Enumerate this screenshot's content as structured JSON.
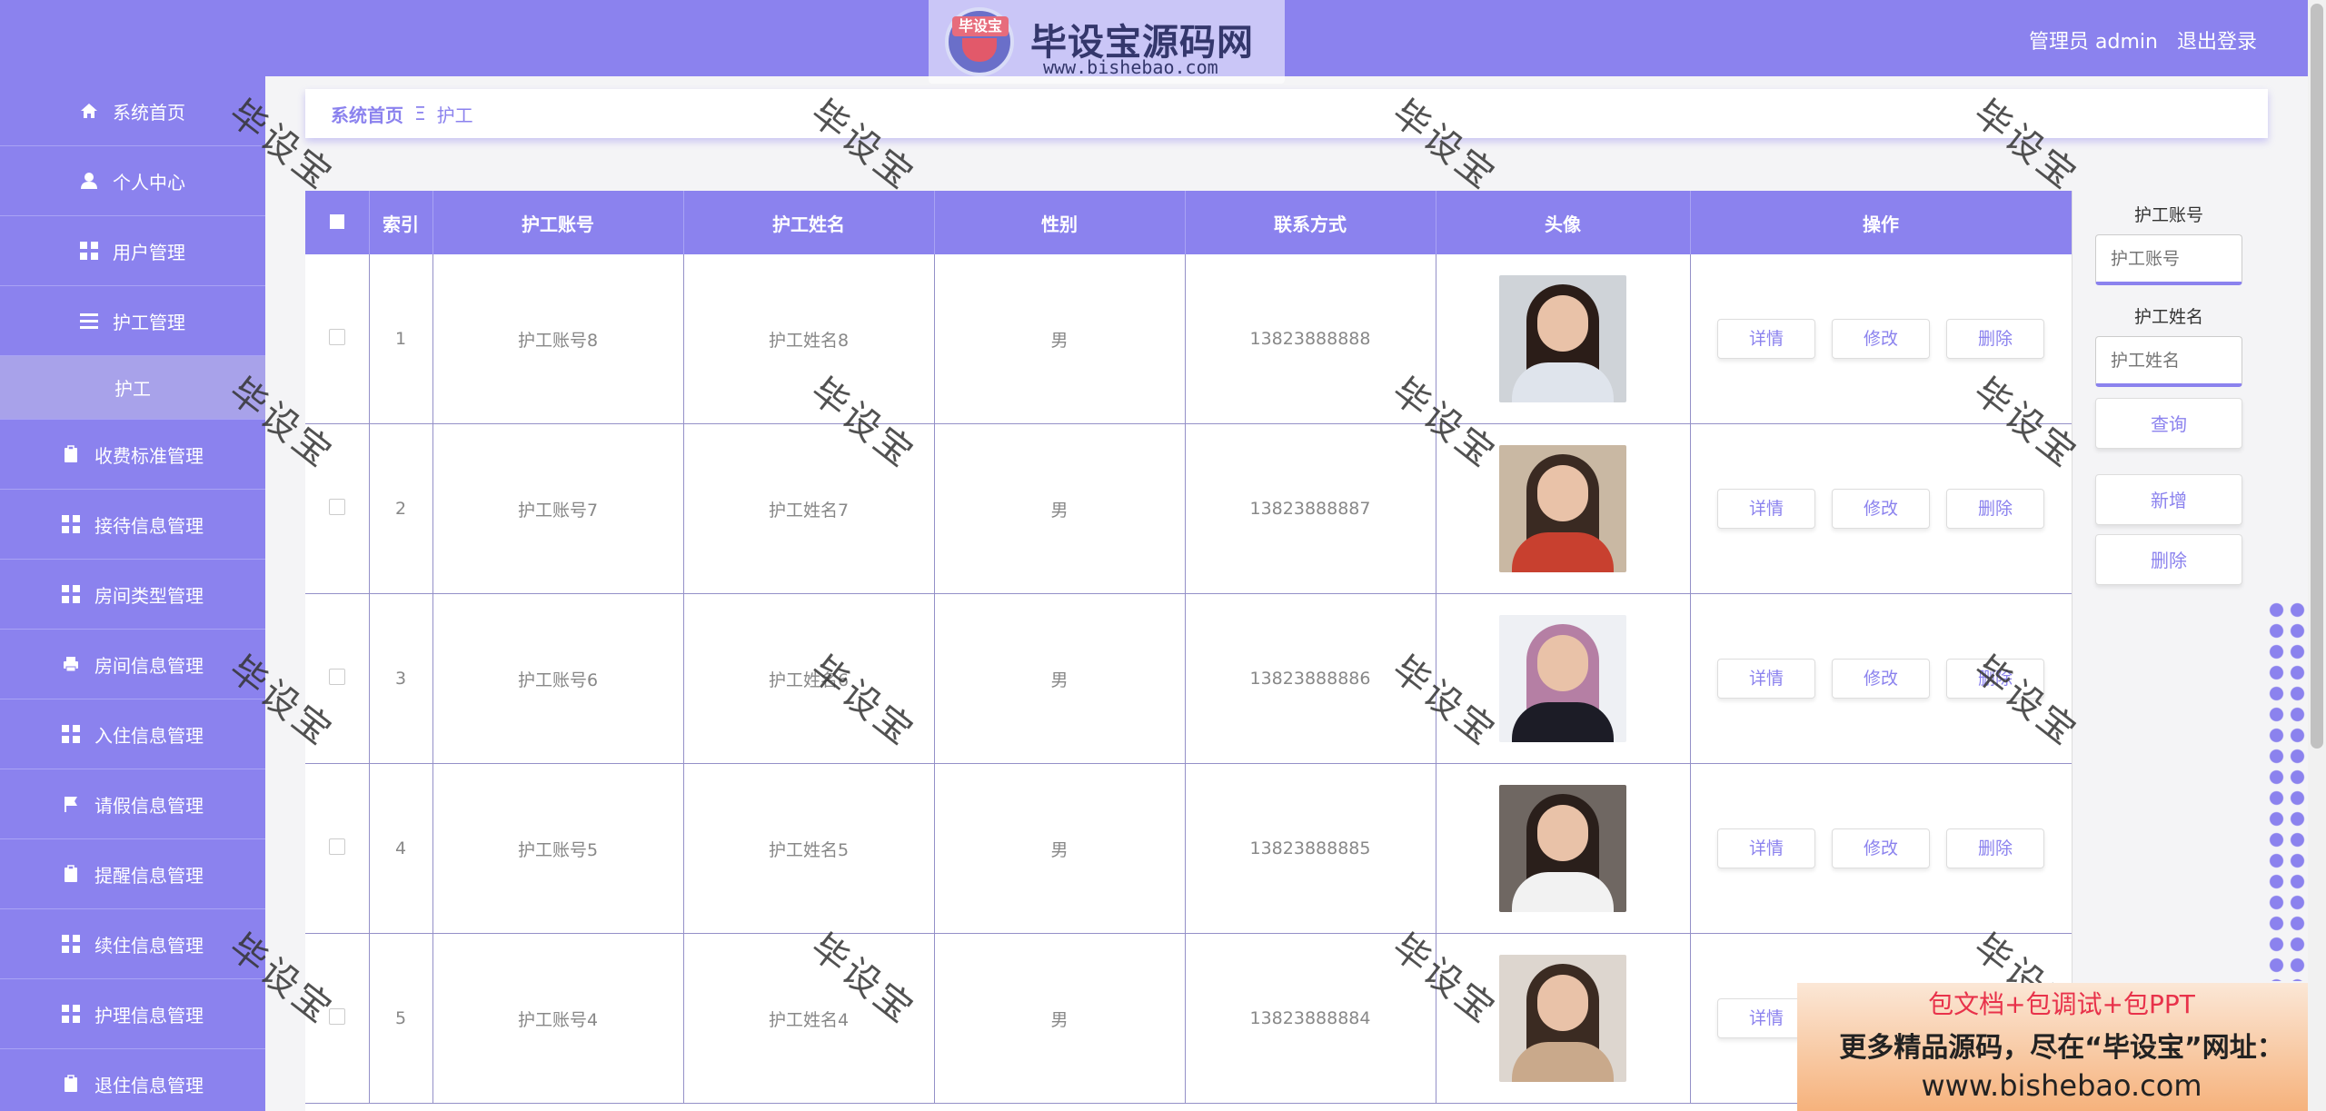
{
  "header": {
    "logo_badge": "毕设宝",
    "logo_title": "毕设宝源码网",
    "logo_url": "www.bishebao.com",
    "user_label": "管理员 admin",
    "logout_label": "退出登录"
  },
  "sidebar": {
    "items": [
      {
        "label": "系统首页",
        "icon": "home-icon"
      },
      {
        "label": "个人中心",
        "icon": "user-icon"
      },
      {
        "label": "用户管理",
        "icon": "grid-icon"
      },
      {
        "label": "护工管理",
        "icon": "list-icon"
      },
      {
        "label": "护工",
        "icon": ""
      },
      {
        "label": "收费标准管理",
        "icon": "clipboard-icon"
      },
      {
        "label": "接待信息管理",
        "icon": "grid-icon"
      },
      {
        "label": "房间类型管理",
        "icon": "grid-icon"
      },
      {
        "label": "房间信息管理",
        "icon": "printer-icon"
      },
      {
        "label": "入住信息管理",
        "icon": "grid-icon"
      },
      {
        "label": "请假信息管理",
        "icon": "flag-icon"
      },
      {
        "label": "提醒信息管理",
        "icon": "clipboard-icon"
      },
      {
        "label": "续住信息管理",
        "icon": "grid-icon"
      },
      {
        "label": "护理信息管理",
        "icon": "grid-icon"
      },
      {
        "label": "退住信息管理",
        "icon": "clipboard-icon"
      }
    ]
  },
  "breadcrumb": {
    "home": "系统首页",
    "separator": "Ξ",
    "current": "护工"
  },
  "table": {
    "headers": [
      "",
      "索引",
      "护工账号",
      "护工姓名",
      "性别",
      "联系方式",
      "头像",
      "操作"
    ],
    "rows": [
      {
        "index": "1",
        "account": "护工账号8",
        "name": "护工姓名8",
        "gender": "男",
        "phone": "13823888888"
      },
      {
        "index": "2",
        "account": "护工账号7",
        "name": "护工姓名7",
        "gender": "男",
        "phone": "13823888887"
      },
      {
        "index": "3",
        "account": "护工账号6",
        "name": "护工姓名6",
        "gender": "男",
        "phone": "13823888886"
      },
      {
        "index": "4",
        "account": "护工账号5",
        "name": "护工姓名5",
        "gender": "男",
        "phone": "13823888885"
      },
      {
        "index": "5",
        "account": "护工账号4",
        "name": "护工姓名4",
        "gender": "男",
        "phone": "13823888884"
      }
    ],
    "actions": {
      "detail": "详情",
      "edit": "修改",
      "delete": "删除"
    }
  },
  "search": {
    "account_label": "护工账号",
    "account_placeholder": "护工账号",
    "name_label": "护工姓名",
    "name_placeholder": "护工姓名",
    "query_button": "查询",
    "add_button": "新增",
    "delete_button": "删除"
  },
  "watermark": "毕设宝",
  "promo": {
    "line1": "包文档+包调试+包PPT",
    "line2": "更多精品源码，尽在“毕设宝”网址：",
    "line3": "www.bishebao.com"
  },
  "colors": {
    "accent": "#8b82ee",
    "promo_red": "#e8324a"
  }
}
